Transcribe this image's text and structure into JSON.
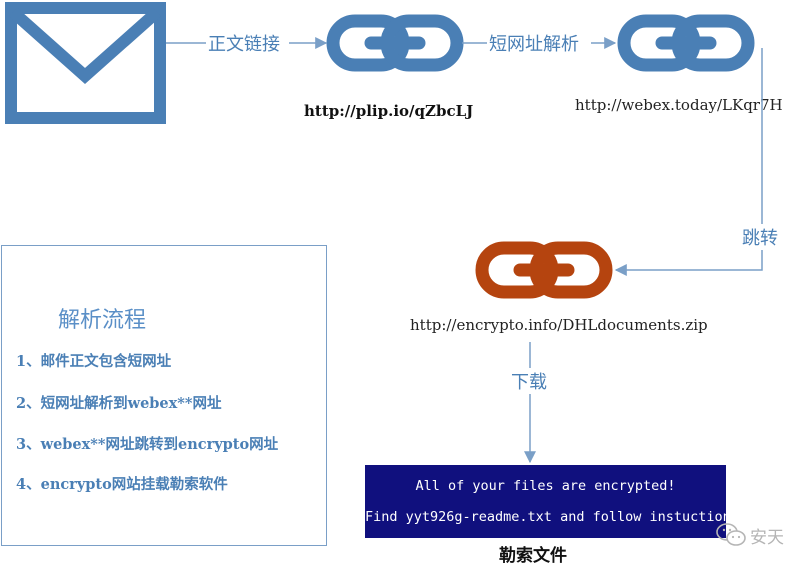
{
  "edges": {
    "body_link": "正文链接",
    "short_resolve": "短网址解析",
    "redirect": "跳转",
    "download": "下载"
  },
  "urls": {
    "short": "http://plip.io/qZbcLJ",
    "webex": "http://webex.today/LKqr7H",
    "encrypto": "http://encrypto.info/DHLdocuments.zip"
  },
  "process": {
    "title": "解析流程",
    "steps": [
      "1、邮件正文包含短网址",
      "2、短网址解析到webex**网址",
      "3、webex**网址跳转到encrypto网址",
      "4、encrypto网站挂载勒索软件"
    ]
  },
  "ransom": {
    "line1": "All of your files are encrypted!",
    "line2": "Find yyt926g-readme.txt and follow instuctions",
    "caption": "勒索文件"
  },
  "watermark": "安天",
  "icons": {
    "envelope": "envelope-icon",
    "link": "chain-link-icon",
    "watermark": "wechat-icon"
  },
  "colors": {
    "blue": "#4a7fb5",
    "orange": "#b5440f",
    "ransom_bg": "#10107e"
  }
}
